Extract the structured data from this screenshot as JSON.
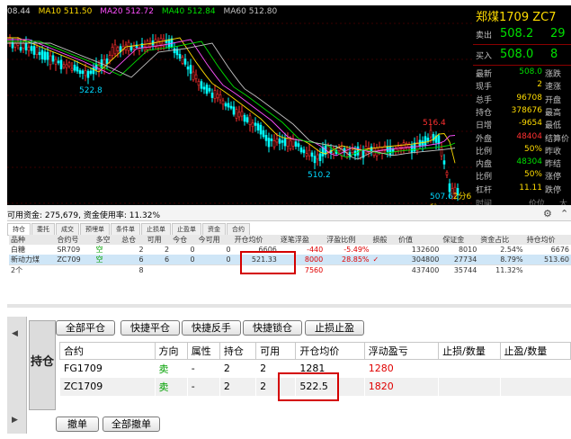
{
  "ma_bar": {
    "first": "08.44",
    "ma10": "MA10 511.50",
    "ma20": "MA20 512.72",
    "ma40": "MA40 512.84",
    "ma60": "MA60 512.80"
  },
  "chart_labels": {
    "high_left": "522.8",
    "high_right": "516.4",
    "low_mid": "510.2",
    "last": "507.6",
    "last_suffix": "2分6秒"
  },
  "quote": {
    "title": "郑煤1709  ZC7",
    "sell_label": "卖出",
    "sell_price": "508.2",
    "sell_vol": "29",
    "buy_label": "买入",
    "buy_price": "508.0",
    "buy_vol": "8",
    "rows": [
      {
        "label": "最新",
        "value": "508.0",
        "color": "#00e000",
        "right": "涨跌"
      },
      {
        "label": "现手",
        "value": "2",
        "color": "#ffdc00",
        "right": "速涨"
      },
      {
        "label": "总手",
        "value": "96708",
        "color": "#ffdc00",
        "right": "开盘"
      },
      {
        "label": "持仓",
        "value": "378676",
        "color": "#ffdc00",
        "right": "最高"
      },
      {
        "label": "日增",
        "value": "-9654",
        "color": "#ffdc00",
        "right": "最低"
      },
      {
        "label": "外盘",
        "value": "48404",
        "color": "#ff3030",
        "right": "结算价"
      },
      {
        "label": "比例",
        "value": "50%",
        "color": "#ffdc00",
        "right": "昨收"
      },
      {
        "label": "内盘",
        "value": "48304",
        "color": "#00e000",
        "right": "昨结"
      },
      {
        "label": "比例",
        "value": "50%",
        "color": "#ffdc00",
        "right": "涨停"
      },
      {
        "label": "杠杆",
        "value": "11.11",
        "color": "#ffdc00",
        "right": "跌停"
      }
    ],
    "foot_time": "时间",
    "foot_price": "价位",
    "foot_vol": "大"
  },
  "account": {
    "text": "可用资金: 275,679, 资金使用率: 11.32%",
    "gear": "⚙",
    "caret": "⌃"
  },
  "mini_tabs": [
    "持仓",
    "委托",
    "成交",
    "预埋单",
    "条件单",
    "止损单",
    "止盈单",
    "资金",
    "合约"
  ],
  "mini_table": {
    "headers": [
      "品种",
      "合约号",
      "多空",
      "总仓",
      "可用",
      "今仓",
      "今可用",
      "开仓均价",
      "逐笔浮盈",
      "浮盈比例",
      "损般",
      "价值",
      "保证金",
      "资金占比",
      "持仓均价"
    ],
    "rows": [
      [
        "白糖",
        "SR709",
        "空",
        "2",
        "2",
        "0",
        "0",
        "6606",
        "-440",
        "-5.49%",
        "",
        "132600",
        "8010",
        "2.54%",
        "6676"
      ],
      [
        "新动力煤",
        "ZC709",
        "空",
        "6",
        "6",
        "0",
        "0",
        "521.33",
        "8000",
        "28.85%",
        "✓",
        "304800",
        "27734",
        "8.79%",
        "513.60"
      ]
    ],
    "sum": [
      "2个",
      "",
      "",
      "8",
      "",
      "",
      "",
      "",
      "7560",
      "",
      "",
      "437400",
      "35744",
      "11.32%",
      ""
    ]
  },
  "buttons": {
    "close_all": "全部平仓",
    "quick_close": "快捷平仓",
    "quick_reverse": "快捷反手",
    "quick_lock": "快捷锁仓",
    "stop_set": "止损止盈",
    "cancel": "撤单",
    "cancel_all": "全部撤单"
  },
  "hold_tab": "持仓",
  "grid": {
    "headers": [
      "合约",
      "方向",
      "属性",
      "持仓",
      "可用",
      "开仓均价",
      "浮动盈亏",
      "止损/数量",
      "止盈/数量"
    ],
    "rows": [
      [
        "FG1709",
        "卖",
        "-",
        "2",
        "2",
        "1281",
        "1280",
        "",
        ""
      ],
      [
        "ZC1709",
        "卖",
        "-",
        "2",
        "2",
        "522.5",
        "1820",
        "",
        ""
      ]
    ]
  }
}
